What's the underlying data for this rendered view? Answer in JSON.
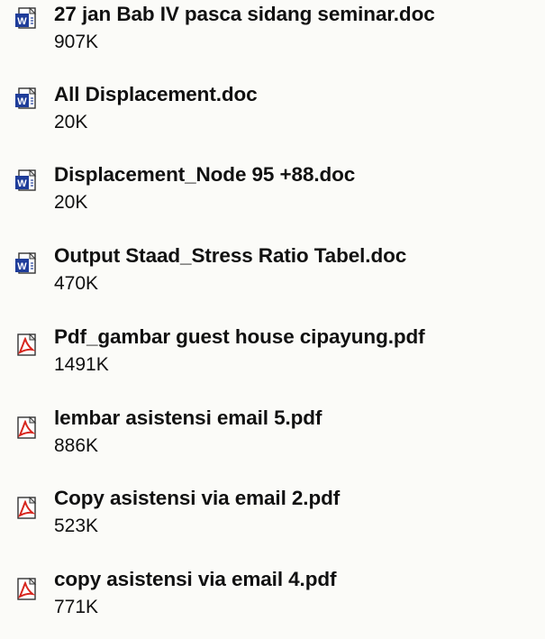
{
  "files": [
    {
      "name": "27 jan Bab IV pasca sidang seminar.doc",
      "size": "907K",
      "type": "doc",
      "icon": "word-doc-icon"
    },
    {
      "name": "All Displacement.doc",
      "size": "20K",
      "type": "doc",
      "icon": "word-doc-icon"
    },
    {
      "name": "Displacement_Node 95 +88.doc",
      "size": "20K",
      "type": "doc",
      "icon": "word-doc-icon"
    },
    {
      "name": "Output Staad_Stress Ratio Tabel.doc",
      "size": "470K",
      "type": "doc",
      "icon": "word-doc-icon"
    },
    {
      "name": "Pdf_gambar guest house cipayung.pdf",
      "size": "1491K",
      "type": "pdf",
      "icon": "pdf-icon"
    },
    {
      "name": "lembar asistensi email 5.pdf",
      "size": "886K",
      "type": "pdf",
      "icon": "pdf-icon"
    },
    {
      "name": "Copy asistensi via email 2.pdf",
      "size": "523K",
      "type": "pdf",
      "icon": "pdf-icon"
    },
    {
      "name": "copy asistensi via email 4.pdf",
      "size": "771K",
      "type": "pdf",
      "icon": "pdf-icon"
    }
  ],
  "colors": {
    "word_icon_blue": "#1f3d9a",
    "pdf_icon_red": "#d7261e"
  }
}
